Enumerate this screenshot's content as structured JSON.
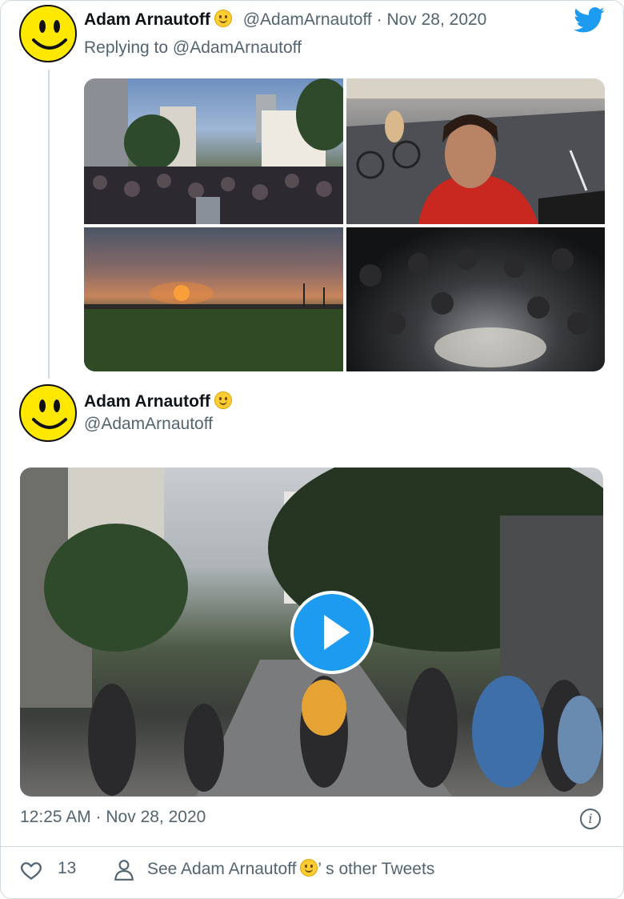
{
  "tweet1": {
    "name": "Adam Arnautoff",
    "handle": "@AdamArnautoff",
    "date_sep": " · ",
    "date": "Nov 28, 2020",
    "replying_to": "Replying to @AdamArnautoff"
  },
  "tweet2": {
    "name": "Adam Arnautoff",
    "handle": "@AdamArnautoff"
  },
  "meta": {
    "timestamp": "12:25 AM · Nov 28, 2020"
  },
  "actions": {
    "like_count": "13",
    "see_prefix": "See Adam Arnautoff",
    "see_suffix": "’ s other Tweets"
  },
  "icons": {
    "brand": "twitter-bird-icon",
    "like": "heart-icon",
    "profile": "person-icon",
    "info": "info-icon"
  },
  "colors": {
    "accent": "#1d9bf0",
    "muted_text": "#536471",
    "avatar_yellow": "#ffe800"
  }
}
